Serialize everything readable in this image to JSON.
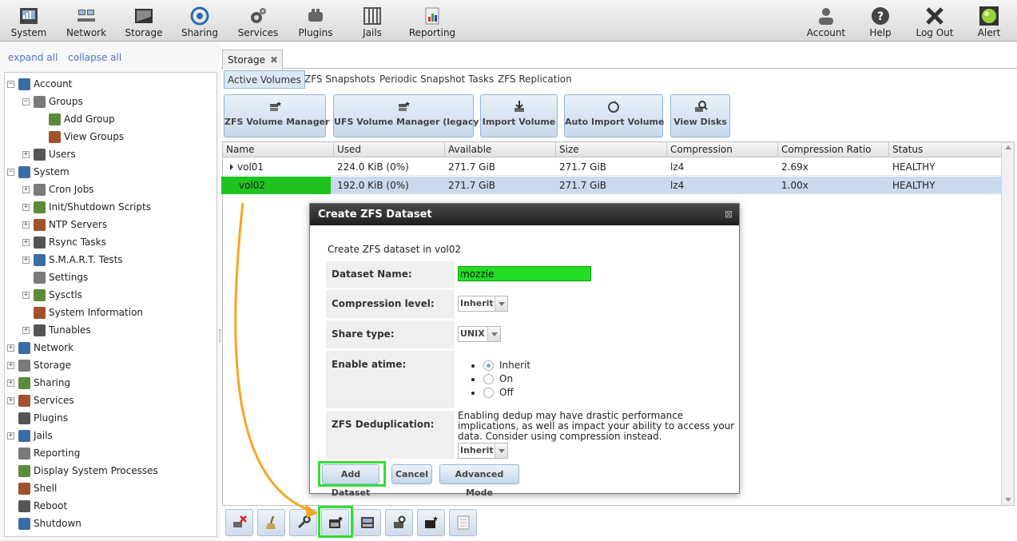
{
  "toolbar": {
    "left": [
      {
        "label": "System",
        "icon": "system-icon"
      },
      {
        "label": "Network",
        "icon": "network-icon"
      },
      {
        "label": "Storage",
        "icon": "storage-icon"
      },
      {
        "label": "Sharing",
        "icon": "sharing-icon"
      },
      {
        "label": "Services",
        "icon": "services-icon"
      },
      {
        "label": "Plugins",
        "icon": "plugins-icon"
      },
      {
        "label": "Jails",
        "icon": "jails-icon"
      },
      {
        "label": "Reporting",
        "icon": "reporting-icon"
      }
    ],
    "right": [
      {
        "label": "Account",
        "icon": "account-icon"
      },
      {
        "label": "Help",
        "icon": "help-icon"
      },
      {
        "label": "Log Out",
        "icon": "logout-icon"
      },
      {
        "label": "Alert",
        "icon": "alert-icon"
      }
    ]
  },
  "tree": {
    "expand_all": "expand all",
    "collapse_all": "collapse all",
    "items": [
      {
        "label": "Account",
        "toggle": "-",
        "level": 0
      },
      {
        "label": "Groups",
        "toggle": "-",
        "level": 1
      },
      {
        "label": "Add Group",
        "toggle": "",
        "level": 2
      },
      {
        "label": "View Groups",
        "toggle": "",
        "level": 2
      },
      {
        "label": "Users",
        "toggle": "+",
        "level": 1
      },
      {
        "label": "System",
        "toggle": "-",
        "level": 0
      },
      {
        "label": "Cron Jobs",
        "toggle": "+",
        "level": 1
      },
      {
        "label": "Init/Shutdown Scripts",
        "toggle": "+",
        "level": 1
      },
      {
        "label": "NTP Servers",
        "toggle": "+",
        "level": 1
      },
      {
        "label": "Rsync Tasks",
        "toggle": "+",
        "level": 1
      },
      {
        "label": "S.M.A.R.T. Tests",
        "toggle": "+",
        "level": 1
      },
      {
        "label": "Settings",
        "toggle": "",
        "level": 1
      },
      {
        "label": "Sysctls",
        "toggle": "+",
        "level": 1
      },
      {
        "label": "System Information",
        "toggle": "",
        "level": 1
      },
      {
        "label": "Tunables",
        "toggle": "+",
        "level": 1
      },
      {
        "label": "Network",
        "toggle": "+",
        "level": 0
      },
      {
        "label": "Storage",
        "toggle": "+",
        "level": 0
      },
      {
        "label": "Sharing",
        "toggle": "+",
        "level": 0
      },
      {
        "label": "Services",
        "toggle": "+",
        "level": 0
      },
      {
        "label": "Plugins",
        "toggle": "",
        "level": 0
      },
      {
        "label": "Jails",
        "toggle": "+",
        "level": 0
      },
      {
        "label": "Reporting",
        "toggle": "",
        "level": 0
      },
      {
        "label": "Display System Processes",
        "toggle": "",
        "level": 0
      },
      {
        "label": "Shell",
        "toggle": "",
        "level": 0
      },
      {
        "label": "Reboot",
        "toggle": "",
        "level": 0
      },
      {
        "label": "Shutdown",
        "toggle": "",
        "level": 0
      }
    ]
  },
  "main": {
    "tab_label": "Storage",
    "tab_close": "✖",
    "subtabs": [
      "Active Volumes",
      "ZFS Snapshots",
      "Periodic Snapshot Tasks",
      "ZFS Replication"
    ],
    "actions": [
      "ZFS Volume Manager",
      "UFS Volume Manager (legacy)",
      "Import Volume",
      "Auto Import Volume",
      "View Disks"
    ],
    "columns": [
      "Name",
      "Used",
      "Available",
      "Size",
      "Compression",
      "Compression Ratio",
      "Status"
    ],
    "rows": [
      {
        "name": "vol01",
        "used": "224.0 KiB (0%)",
        "available": "271.7 GiB",
        "size": "271.7 GiB",
        "compression": "lz4",
        "ratio": "2.69x",
        "status": "HEALTHY"
      },
      {
        "name": "vol02",
        "used": "192.0 KiB (0%)",
        "available": "271.7 GiB",
        "size": "271.7 GiB",
        "compression": "lz4",
        "ratio": "1.00x",
        "status": "HEALTHY"
      }
    ]
  },
  "dialog": {
    "title": "Create ZFS Dataset",
    "close": "⊠",
    "intro": "Create ZFS dataset in vol02",
    "name_label": "Dataset Name:",
    "name_value": "mozzie",
    "compression_label": "Compression level:",
    "compression_value": "Inherit",
    "share_label": "Share type:",
    "share_value": "UNIX",
    "atime_label": "Enable atime:",
    "atime_options": [
      "Inherit",
      "On",
      "Off"
    ],
    "dedup_label": "ZFS Deduplication:",
    "dedup_note": "Enabling dedup may have drastic performance implications, as well as impact your ability to access your data. Consider using compression instead.",
    "dedup_value": "Inherit",
    "buttons": {
      "add": "Add Dataset",
      "cancel": "Cancel",
      "advanced": "Advanced Mode"
    }
  },
  "colors": {
    "highlight": "#33dd33",
    "annotation_arrow": "#f5a623",
    "selected_row": "#c9daee"
  }
}
